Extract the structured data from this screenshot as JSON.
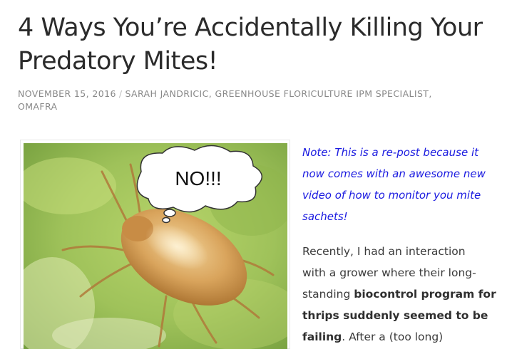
{
  "post": {
    "title_line1": "4 Ways You’re Accidentally Killing Your",
    "title_line2": "Predatory Mites!",
    "date": "NOVEMBER 15, 2016",
    "separator": "/",
    "author_line1": "SARAH JANDRICIC, GREENHOUSE FLORICULTURE IPM SPECIALIST,",
    "author_line2": "OMAFRA"
  },
  "figure": {
    "bubble_text": "NO!!!",
    "image_subject": "predatory-mite-on-leaf"
  },
  "note": {
    "line1": "Note: This is a re-post because it",
    "line2": "now comes with an awesome new",
    "line3": "video of how to monitor you mite",
    "line4": "sachets!"
  },
  "body": {
    "l1": "Recently, I had an interaction",
    "l2": "with a grower where their long-",
    "l3_plain": "standing ",
    "l3_bold": "biocontrol program for",
    "l4_bold": "thrips suddenly seemed to be",
    "l5_bold": "failing",
    "l5_plain": ". After a (too long)"
  },
  "colors": {
    "note_text": "#1a1ae0",
    "meta_text": "#888888",
    "title_text": "#2b2b2b"
  }
}
